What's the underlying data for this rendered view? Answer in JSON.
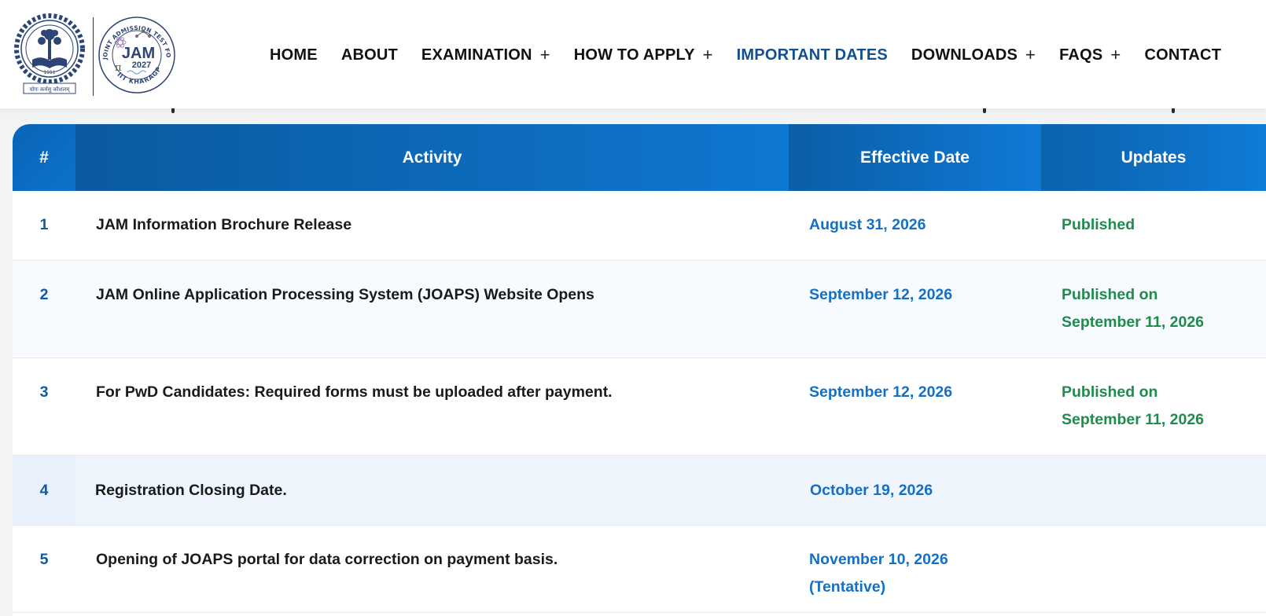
{
  "header": {
    "logos": {
      "iit_seal_motto": "योगः कर्मसु कौशलम्",
      "iit_seal_year": "1951",
      "jam_title": "JAM",
      "jam_year": "2027",
      "jam_ring_text": "JOINT ADMISSION TEST FOR MASTERS",
      "jam_ring_bottom": "IIT KHARAGPUR"
    },
    "nav": [
      {
        "label": "HOME",
        "has_submenu": false,
        "active": false
      },
      {
        "label": "ABOUT",
        "has_submenu": false,
        "active": false
      },
      {
        "label": "EXAMINATION",
        "has_submenu": true,
        "active": false
      },
      {
        "label": "HOW TO APPLY",
        "has_submenu": true,
        "active": false
      },
      {
        "label": "IMPORTANT DATES",
        "has_submenu": false,
        "active": true
      },
      {
        "label": "DOWNLOADS",
        "has_submenu": true,
        "active": false
      },
      {
        "label": "FAQS",
        "has_submenu": true,
        "active": false
      },
      {
        "label": "CONTACT",
        "has_submenu": false,
        "active": false
      }
    ],
    "submenu_glyph": "+"
  },
  "table": {
    "columns": [
      "#",
      "Activity",
      "Effective Date",
      "Updates"
    ],
    "rows": [
      {
        "num": "1",
        "activity": "JAM Information Brochure Release",
        "date": [
          "August 31, 2026"
        ],
        "update": [
          "Published"
        ]
      },
      {
        "num": "2",
        "activity": "JAM Online Application Processing System (JOAPS) Website Opens",
        "date": [
          "September 12, 2026"
        ],
        "update": [
          "Published on",
          "September 11, 2026"
        ]
      },
      {
        "num": "3",
        "activity": "For PwD Candidates: Required forms must be uploaded after payment.",
        "date": [
          "September 12, 2026"
        ],
        "update": [
          "Published on",
          "September 11, 2026"
        ]
      },
      {
        "num": "4",
        "activity": "Registration Closing Date.",
        "date": [
          "October 19, 2026"
        ],
        "update": []
      },
      {
        "num": "5",
        "activity": "Opening of JOAPS portal for data correction on payment basis.",
        "date": [
          "November 10, 2026",
          "(Tentative)"
        ],
        "update": []
      }
    ]
  },
  "colors": {
    "nav_active": "#11508c",
    "header_blue": "#0d6bbd",
    "number_blue": "#0f5aa4",
    "date_blue": "#1470c4",
    "update_green": "#1f8b4c"
  }
}
